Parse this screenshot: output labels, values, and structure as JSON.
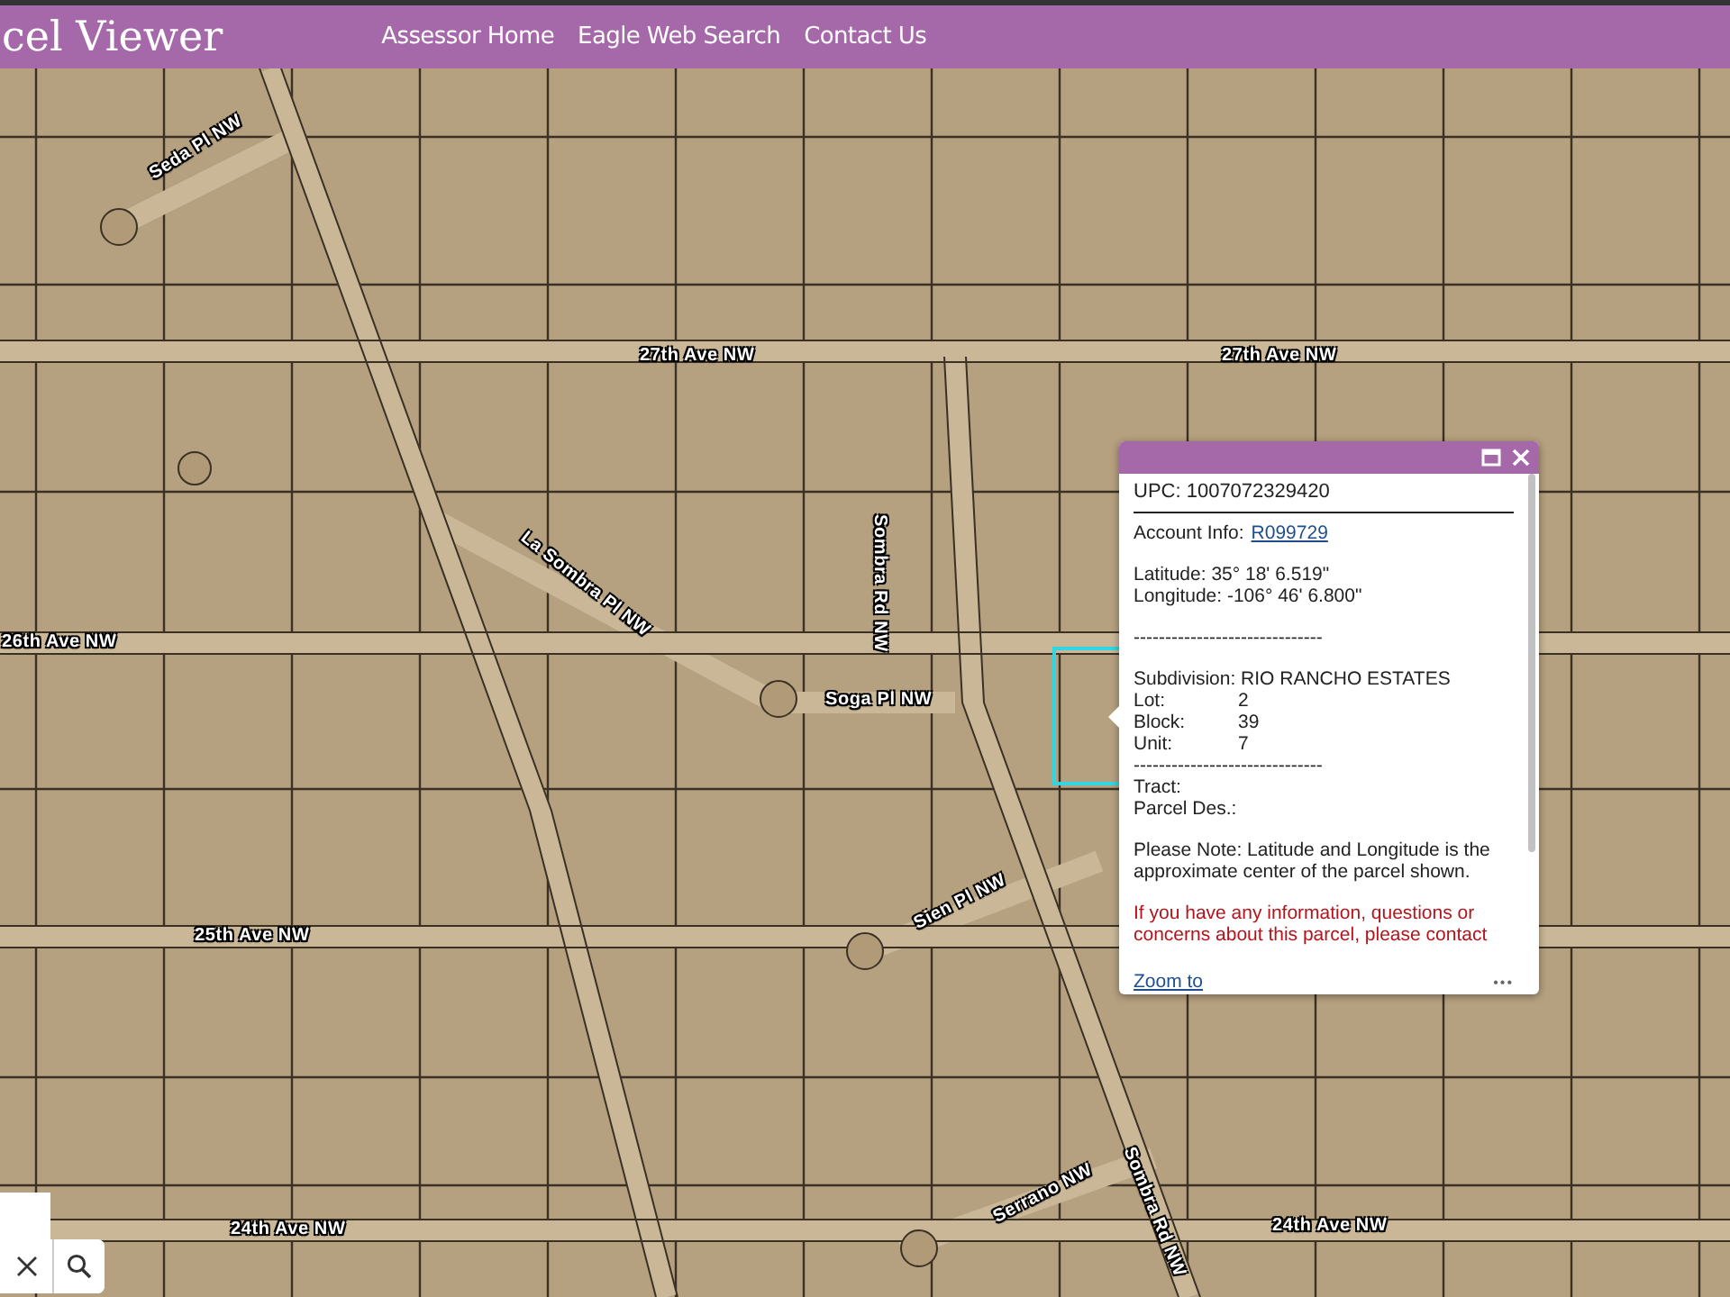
{
  "header": {
    "title": "cel Viewer",
    "links": [
      "Assessor Home",
      "Eagle Web Search",
      "Contact Us"
    ]
  },
  "map": {
    "labels": [
      {
        "text": "Seda Pl NW",
        "kind": "street"
      },
      {
        "text": "27th Ave NW",
        "kind": "street"
      },
      {
        "text": "27th Ave NW",
        "kind": "street"
      },
      {
        "text": "La Sombra Pl NW",
        "kind": "street"
      },
      {
        "text": "Sombra Rd NW",
        "kind": "street"
      },
      {
        "text": "26th Ave NW",
        "kind": "street"
      },
      {
        "text": "Soga Pl NW",
        "kind": "street"
      },
      {
        "text": "Sien Pl NW",
        "kind": "street"
      },
      {
        "text": "25th Ave NW",
        "kind": "street"
      },
      {
        "text": "24th Ave NW",
        "kind": "street"
      },
      {
        "text": "24th Ave NW",
        "kind": "street"
      },
      {
        "text": "Serrano NW",
        "kind": "street"
      },
      {
        "text": "Sombra Rd NW",
        "kind": "street"
      }
    ]
  },
  "popup": {
    "lines": [
      {
        "kind": "heading",
        "text": "UPC: 1007072329420"
      },
      {
        "kind": "link_field",
        "label": "Account Info:",
        "link": "R099729"
      },
      {
        "kind": "para",
        "lines": [
          "Latitude: 35° 18' 6.519\"",
          "Longitude: -106° 46' 6.800\""
        ]
      },
      {
        "kind": "para",
        "lines": [
          "------------------------------"
        ]
      },
      {
        "kind": "para",
        "lines": [
          "Subdivision: RIO RANCHO ESTATES"
        ]
      },
      {
        "kind": "pairs",
        "items": [
          {
            "label": "Lot:",
            "value": "2"
          },
          {
            "label": "Block:",
            "value": "39"
          },
          {
            "label": "Unit:",
            "value": "7"
          }
        ]
      },
      {
        "kind": "lines",
        "lines": [
          "------------------------------",
          "Tract:",
          "Parcel Des.:"
        ]
      },
      {
        "kind": "para",
        "lines": [
          "Please Note: Latitude and Longitude is the approximate center of the parcel shown."
        ]
      },
      {
        "kind": "warning",
        "text": "If you have any information, questions or concerns about this parcel, please contact"
      }
    ],
    "footer_link": "Zoom to",
    "more": "•••"
  }
}
